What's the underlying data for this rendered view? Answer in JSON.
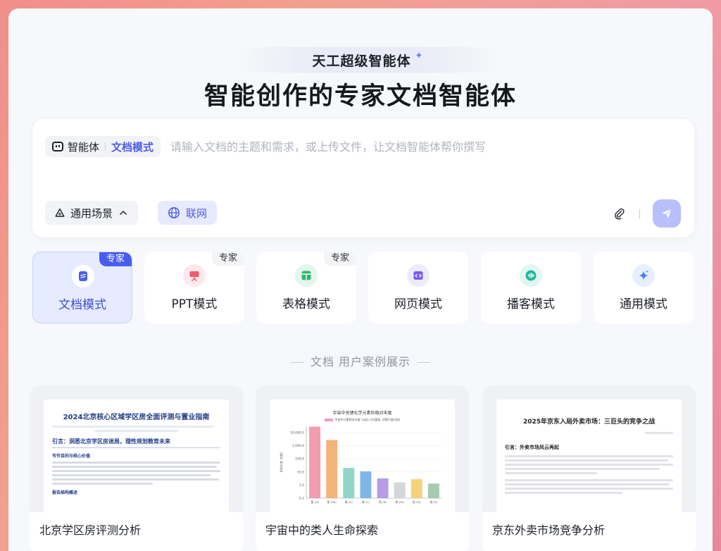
{
  "header": {
    "subtitle": "天工超级智能体",
    "headline": "智能创作的专家文档智能体"
  },
  "input": {
    "agent_label": "智能体",
    "mode_label": "文档模式",
    "placeholder": "请输入文档的主题和需求，或上传文件，让文档智能体帮你撰写",
    "scene_label": "通用场景",
    "web_label": "联网"
  },
  "modes": [
    {
      "label": "文档模式",
      "badge": "专家",
      "active": true,
      "icon": "document-icon",
      "color": "#4a5cf0"
    },
    {
      "label": "PPT模式",
      "badge": "专家",
      "active": false,
      "icon": "presentation-icon",
      "color": "#f05a6e"
    },
    {
      "label": "表格模式",
      "badge": "专家",
      "active": false,
      "icon": "table-icon",
      "color": "#2fb56f"
    },
    {
      "label": "网页模式",
      "badge": "",
      "active": false,
      "icon": "code-icon",
      "color": "#7b5cf0"
    },
    {
      "label": "播客模式",
      "badge": "",
      "active": false,
      "icon": "audio-wave-icon",
      "color": "#22b59a"
    },
    {
      "label": "通用模式",
      "badge": "",
      "active": false,
      "icon": "sparkle-icon",
      "color": "#4a7cf0"
    }
  ],
  "section": {
    "title": "文档 用户案例展示"
  },
  "cases": [
    {
      "caption": "北京学区房评测分析",
      "doc_title": "2024北京核心区域学区房全面评测与置业指南",
      "doc_heading": "引言：洞悉北京学区房迷局，理性规划教育未来",
      "doc_subheading": "写作目的与核心价值",
      "doc_subheading2": "报告结构概述"
    },
    {
      "caption": "宇宙中的类人生命探索",
      "chart_title": "宇宙中关键化学元素的相对丰度",
      "chart_legend": "宇宙中元素相对丰度 (以硅=1为基准, 对数尺度比较)"
    },
    {
      "caption": "京东外卖市场竞争分析",
      "doc_title": "2025年京东入局外卖市场：三巨头的竞争之战",
      "doc_heading": "引言：外卖市场风云再起"
    }
  ],
  "chart_data": {
    "type": "bar",
    "title": "宇宙中关键化学元素的相对丰度",
    "legend": [
      "宇宙中元素相对丰度 (以硅=1为基准, 对数尺度比较)"
    ],
    "ylabel": "相对丰度 (对数)",
    "yscale": "log",
    "ylim": [
      0.1,
      30000
    ],
    "yticks": [
      "10,000.0",
      "1,000.0",
      "100.0",
      "10.0",
      "1.0",
      "0.1"
    ],
    "categories": [
      "氢 (H)",
      "氦 (He)",
      "氧 (O)",
      "碳 (C)",
      "氮 (N)",
      "铁 (Fe)",
      "硅 (Si)",
      "硫 (S)"
    ],
    "values": [
      28000,
      2700,
      20,
      11,
      3.2,
      1.6,
      2.8,
      1.3
    ],
    "colors": [
      "#f39bb0",
      "#f2b47a",
      "#8fd6c8",
      "#7fb6e8",
      "#b69be8",
      "#d5d6da",
      "#f3d27a",
      "#a6c9b0"
    ]
  }
}
